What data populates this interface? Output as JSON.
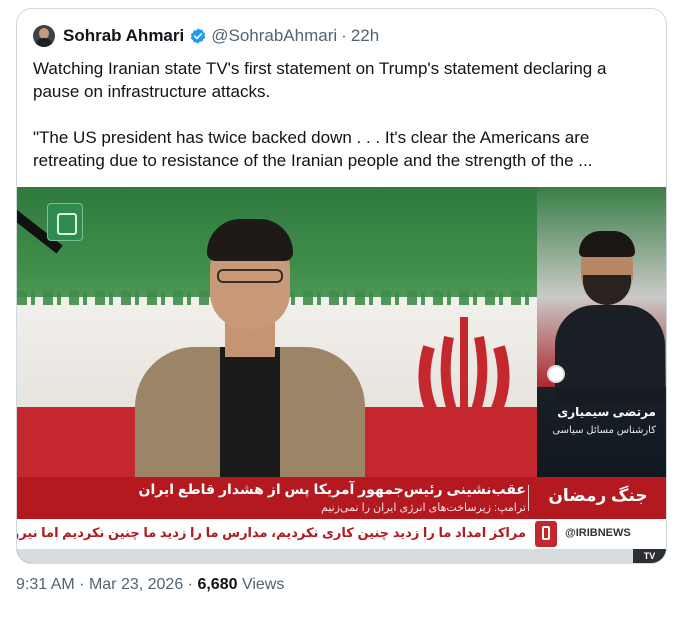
{
  "tweet": {
    "author_name": "Sohrab Ahmari",
    "author_handle": "@SohrabAhmari",
    "separator": "·",
    "time_ago": "22h",
    "verified_color": "#1d9bf0",
    "text_paragraphs": [
      "Watching Iranian state TV's first statement on Trump's statement declaring a pause on infrastructure attacks.",
      "\"The US president has twice backed down . . . It's clear the Americans are retreating due to resistance of the Iranian people and the strength of the ..."
    ]
  },
  "media": {
    "headline": "عقب‌نشینی رئیس‌جمهور آمریکا پس از هشدار قاطع ایران",
    "subline": "ترامپ: زیرساخت‌های انرژی ایران را نمی‌زنیم",
    "show_title": "جنگ رمضان",
    "guest_name": "مرتضی سیمیاری",
    "guest_title": "کارشناس مسائل سیاسی",
    "crawl": "مراکز امداد ما را زدید چنین کاری نکردیم، مدارس ما را زدید ما چنین نکردیم اما نیروگاه برق را بزنید",
    "channel": "@IRIBNEWS",
    "corner_tag": "TV",
    "ticker_color": "#b3191f"
  },
  "meta": {
    "time": "9:31 AM",
    "separator": "·",
    "date": "Mar 23, 2026",
    "views_count": "6,680",
    "views_label": "Views"
  }
}
